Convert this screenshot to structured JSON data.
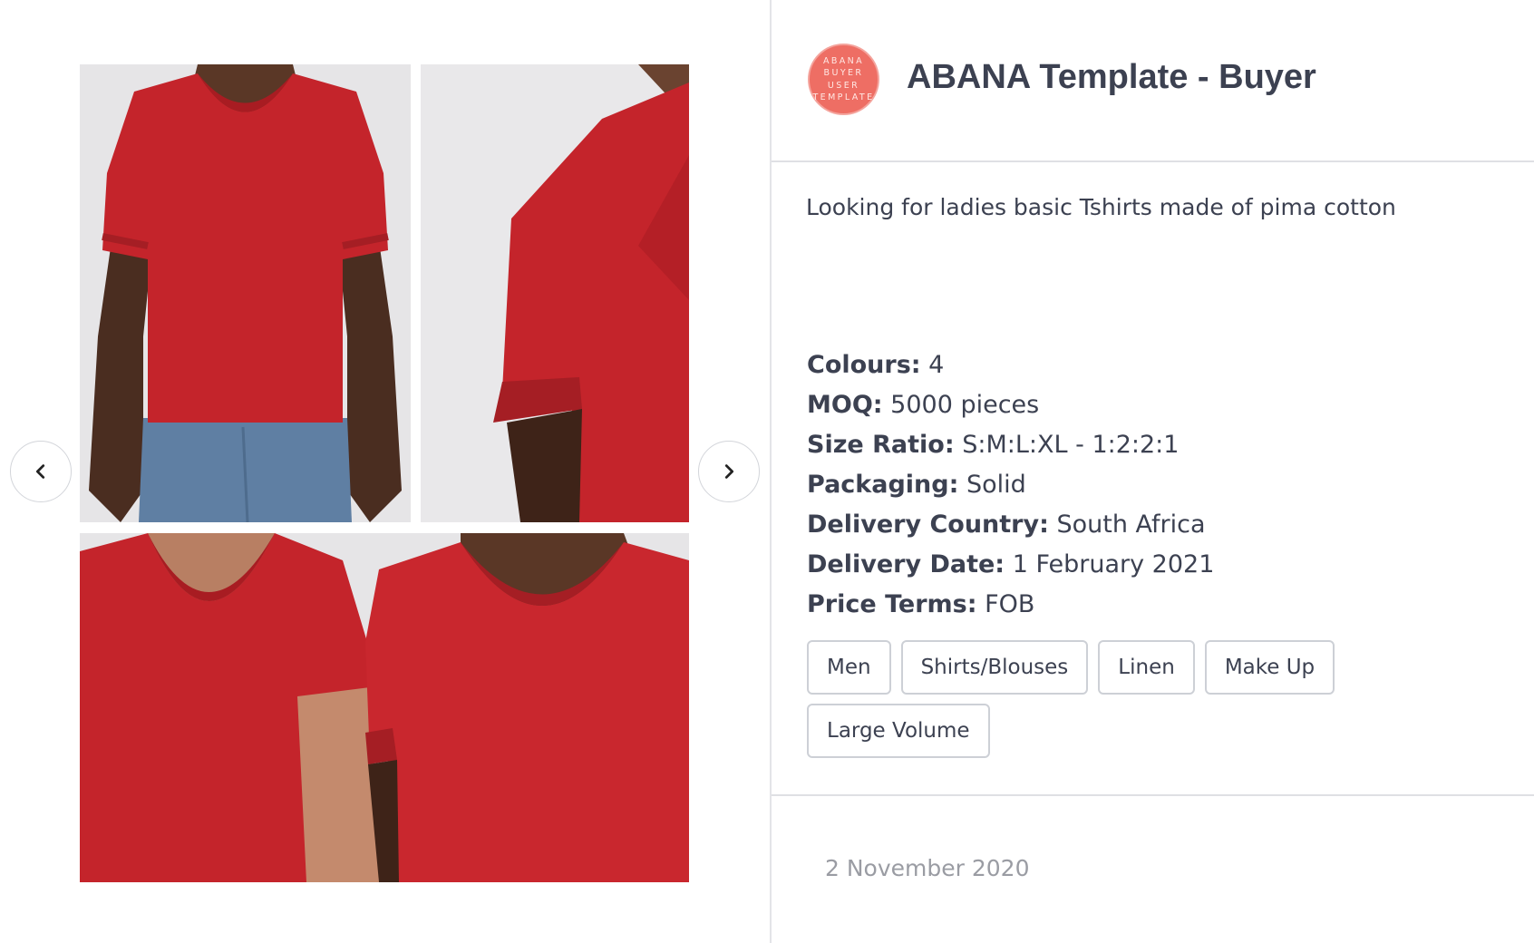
{
  "gallery": {
    "photos": [
      {
        "icon": "photo-woman-red-scoop-tshirt-jeans"
      },
      {
        "icon": "photo-red-tshirt-sleeve-closeup"
      },
      {
        "icon": "photo-two-women-red-tshirts-vneck-scoop"
      }
    ],
    "prev_icon": "chevron-left-icon",
    "next_icon": "chevron-right-icon"
  },
  "post": {
    "avatar_lines": [
      "ABANA",
      "BUYER",
      "USER",
      "TEMPLATE"
    ],
    "avatar_color": "#ee6e64",
    "title": "ABANA Template - Buyer",
    "description": "Looking for ladies basic Tshirts made of pima cotton",
    "specs": [
      {
        "key": "Colours:",
        "value": " 4"
      },
      {
        "key": "MOQ:",
        "value": " 5000 pieces"
      },
      {
        "key": "Size Ratio:",
        "value": " S:M:L:XL - 1:2:2:1"
      },
      {
        "key": "Packaging:",
        "value": " Solid"
      },
      {
        "key": "Delivery Country:",
        "value": " South Africa"
      },
      {
        "key": "Delivery Date:",
        "value": " 1 February 2021"
      },
      {
        "key": "Price Terms:",
        "value": " FOB"
      }
    ],
    "tags": [
      "Men",
      "Shirts/Blouses",
      "Linen",
      "Make Up",
      "Large Volume"
    ],
    "date": "2 November 2020"
  },
  "colors": {
    "text": "#3c4151",
    "muted": "#9a9ca3",
    "shirt_red": "#c4242b",
    "border": "#dfe0e4"
  }
}
